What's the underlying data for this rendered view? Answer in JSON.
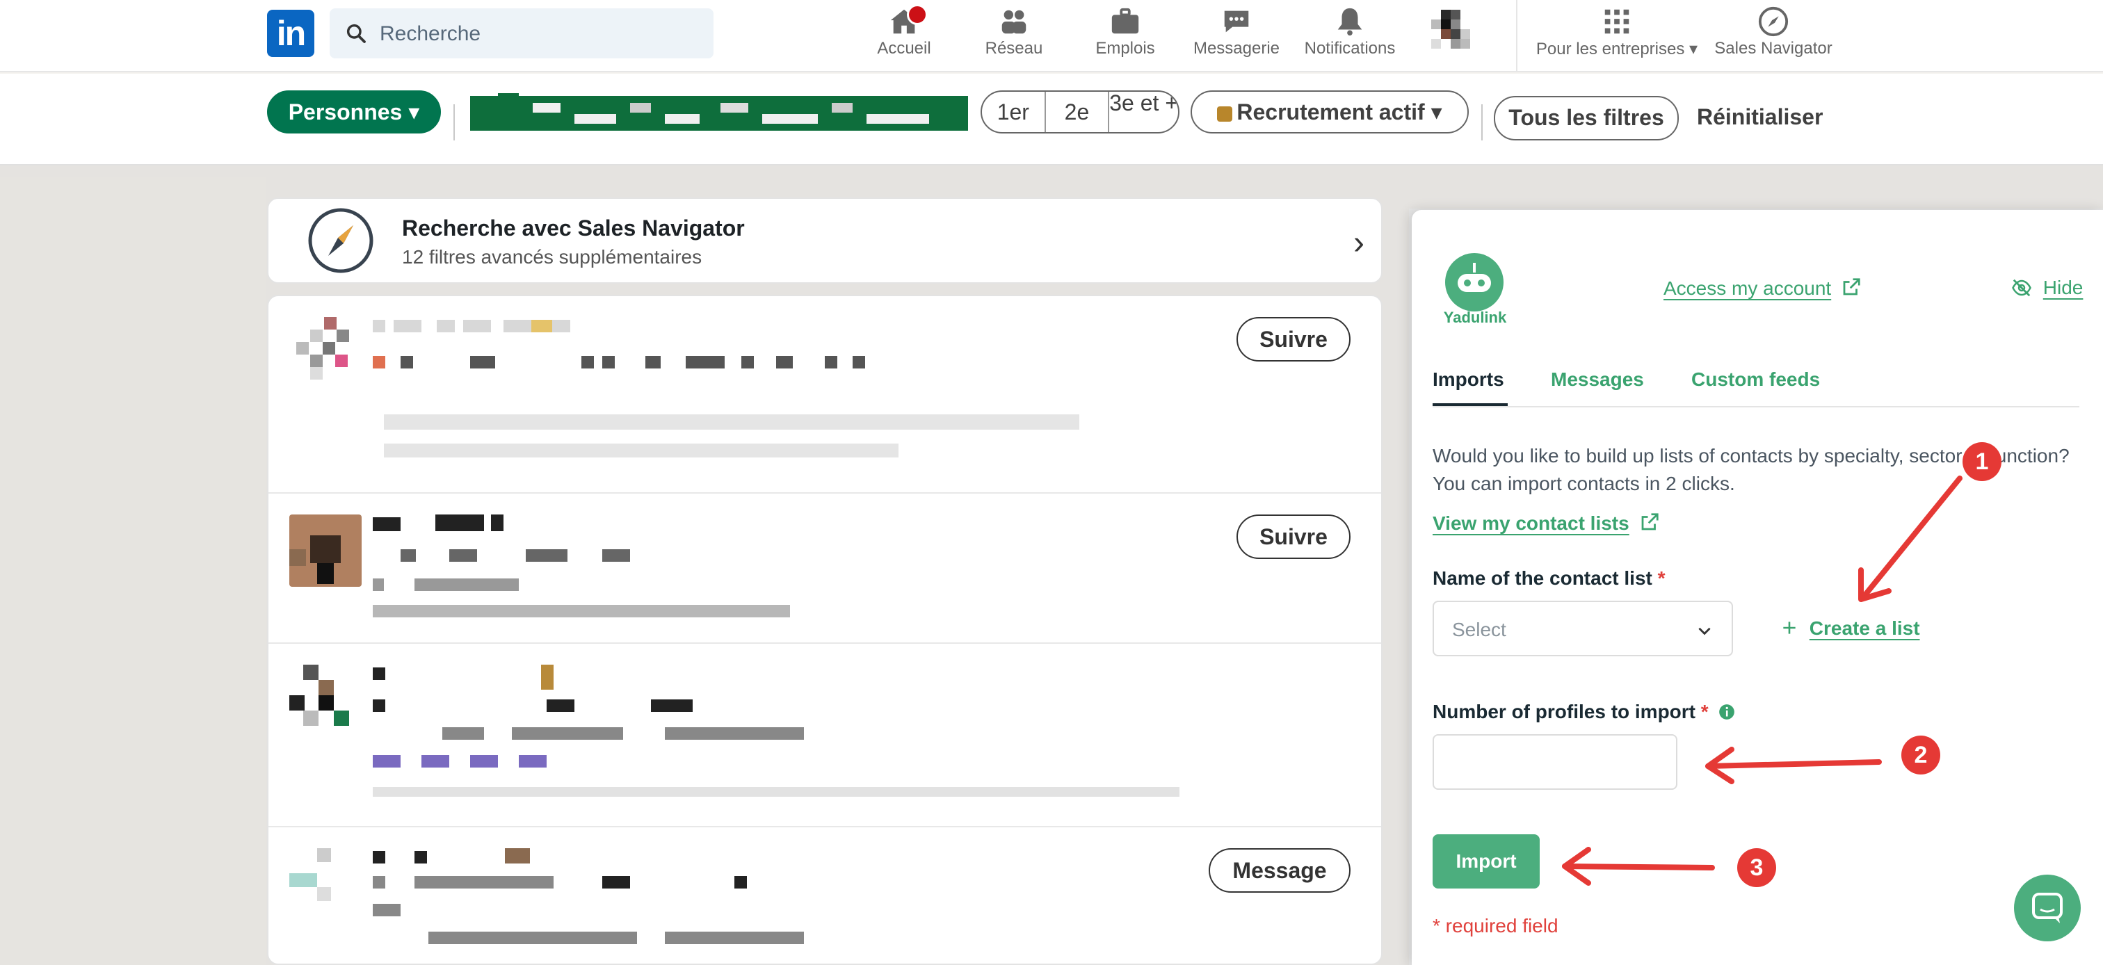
{
  "nav": {
    "search_placeholder": "Recherche",
    "items": [
      {
        "label": "Accueil",
        "icon": "home-icon"
      },
      {
        "label": "Réseau",
        "icon": "people-icon"
      },
      {
        "label": "Emplois",
        "icon": "briefcase-icon"
      },
      {
        "label": "Messagerie",
        "icon": "chat-icon"
      },
      {
        "label": "Notifications",
        "icon": "bell-icon"
      },
      {
        "label": "Pour les entreprises",
        "icon": "grid-icon"
      },
      {
        "label": "Sales Navigator",
        "icon": "compass-icon"
      }
    ]
  },
  "filters": {
    "personnes": "Personnes",
    "degrees": [
      "1er",
      "2e",
      "3e et +"
    ],
    "recrutement": "Recrutement actif",
    "tous_filtres": "Tous les filtres",
    "reset": "Réinitialiser"
  },
  "sales_nav_card": {
    "title": "Recherche avec Sales Navigator",
    "subtitle": "12 filtres avancés supplémentaires"
  },
  "results": {
    "actions": [
      "Suivre",
      "Suivre",
      "Message"
    ]
  },
  "panel": {
    "brand": "Yadulink",
    "access_account": "Access my account",
    "hide": "Hide",
    "tabs": [
      "Imports",
      "Messages",
      "Custom feeds"
    ],
    "intro": "Would you like to build up lists of contacts by specialty, sector or function? You can import contacts in 2 clicks.",
    "view_lists": "View my contact lists",
    "list_label": "Name of the contact list",
    "select_placeholder": "Select",
    "create_list": "Create a list",
    "profiles_label": "Number of profiles to import",
    "profiles_value": "",
    "import_button": "Import",
    "required_note": "* required field",
    "required_mark": "*"
  },
  "annotations": [
    "1",
    "2",
    "3"
  ],
  "colors": {
    "linkedin_blue": "#0a66c2",
    "linkedin_green": "#01754f",
    "yadulink_green": "#4cae7e",
    "annotation_red": "#e53935"
  }
}
